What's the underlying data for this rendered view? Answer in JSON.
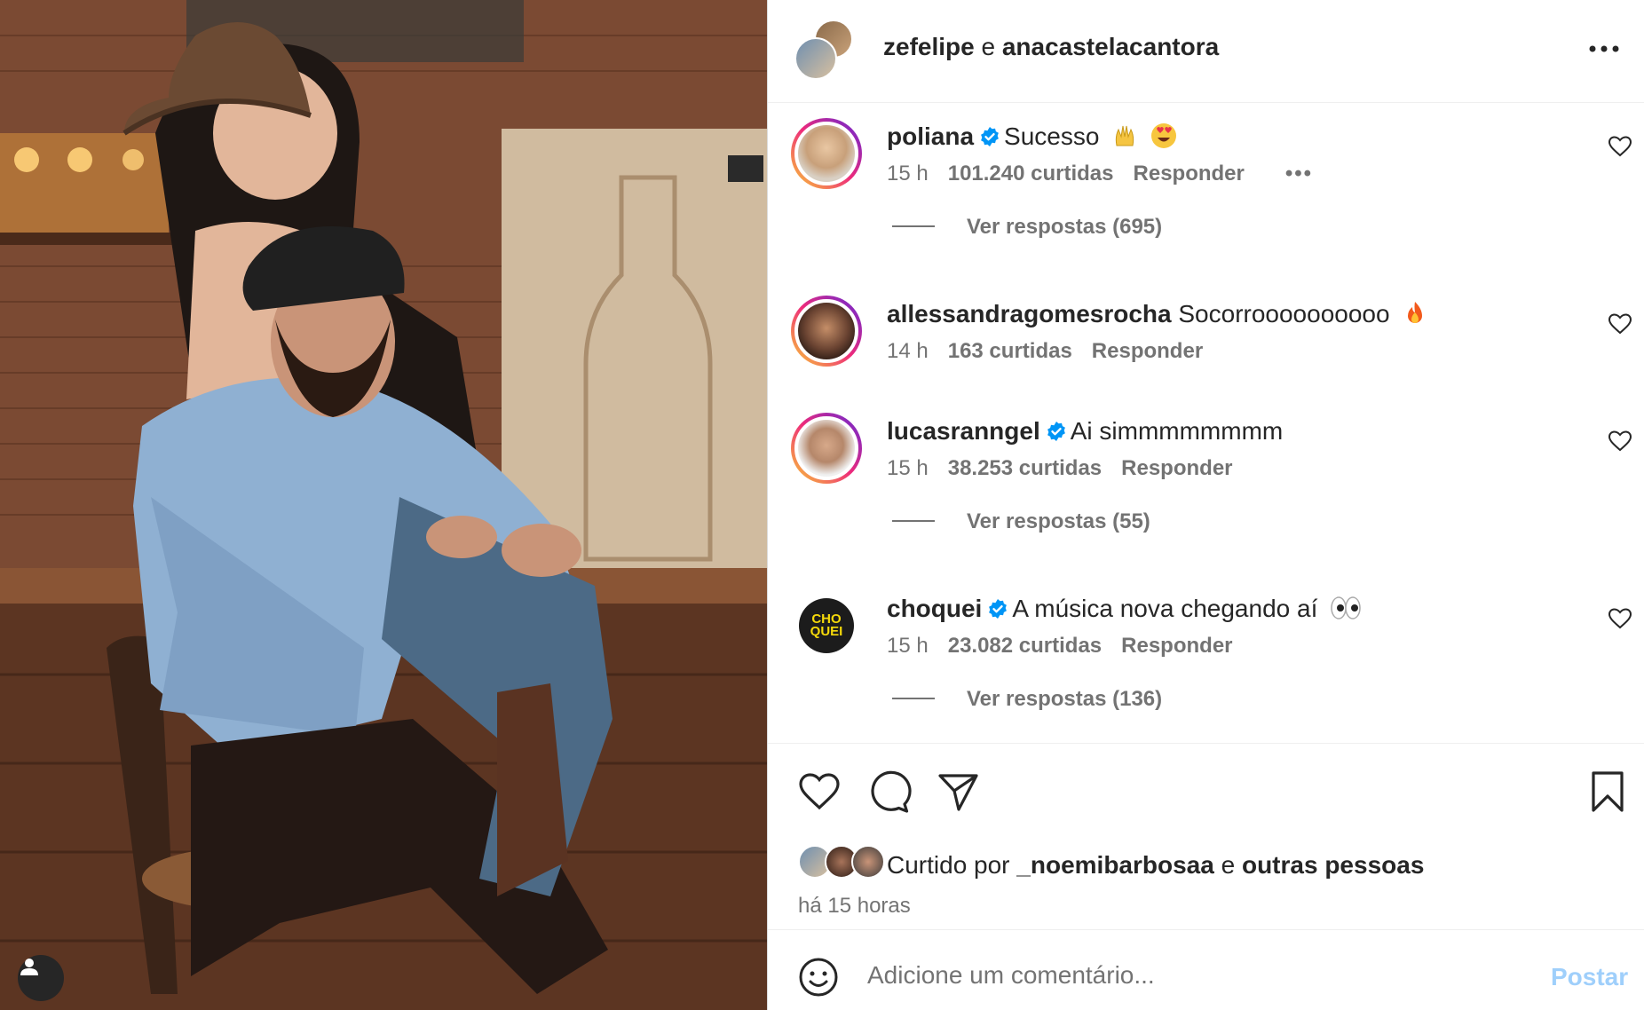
{
  "header": {
    "user1": "zefelipe",
    "connector": " e ",
    "user2": "anacastelacantora"
  },
  "comments": [
    {
      "username": "poliana",
      "verified": true,
      "text": "Sucesso",
      "emojis": [
        "raising-hands-emoji",
        "heart-eyes-emoji"
      ],
      "time": "15 h",
      "likes": "101.240 curtidas",
      "reply_label": "Responder",
      "show_more": true,
      "view_replies": "Ver respostas (695)"
    },
    {
      "username": "allessandragomesrocha",
      "verified": false,
      "text": "Socorroooooooooo",
      "emojis": [
        "fire-emoji"
      ],
      "time": "14 h",
      "likes": "163 curtidas",
      "reply_label": "Responder"
    },
    {
      "username": "lucasranngel",
      "verified": true,
      "text": "Ai simmmmmmmm",
      "time": "15 h",
      "likes": "38.253 curtidas",
      "reply_label": "Responder",
      "view_replies": "Ver respostas (55)"
    },
    {
      "username": "choquei",
      "verified": true,
      "avatar_text": "CHO QUEI",
      "text": "A música nova chegando aí",
      "emojis": [
        "eyes-emoji"
      ],
      "time": "15 h",
      "likes": "23.082 curtidas",
      "reply_label": "Responder",
      "view_replies": "Ver respostas (136)"
    }
  ],
  "liked_by": {
    "prefix": "Curtido por ",
    "user": "_noemibarbosaa",
    "connector": " e ",
    "others": "outras pessoas"
  },
  "time_ago": "há 15 horas",
  "composer": {
    "placeholder": "Adicione um comentário...",
    "post_label": "Postar"
  },
  "colors": {
    "verified": "#0095f6",
    "secondary_text": "#737373",
    "post_disabled": "#9fcffb",
    "story_ring": [
      "#f9ce34",
      "#ee2a7b",
      "#6228d7"
    ]
  }
}
